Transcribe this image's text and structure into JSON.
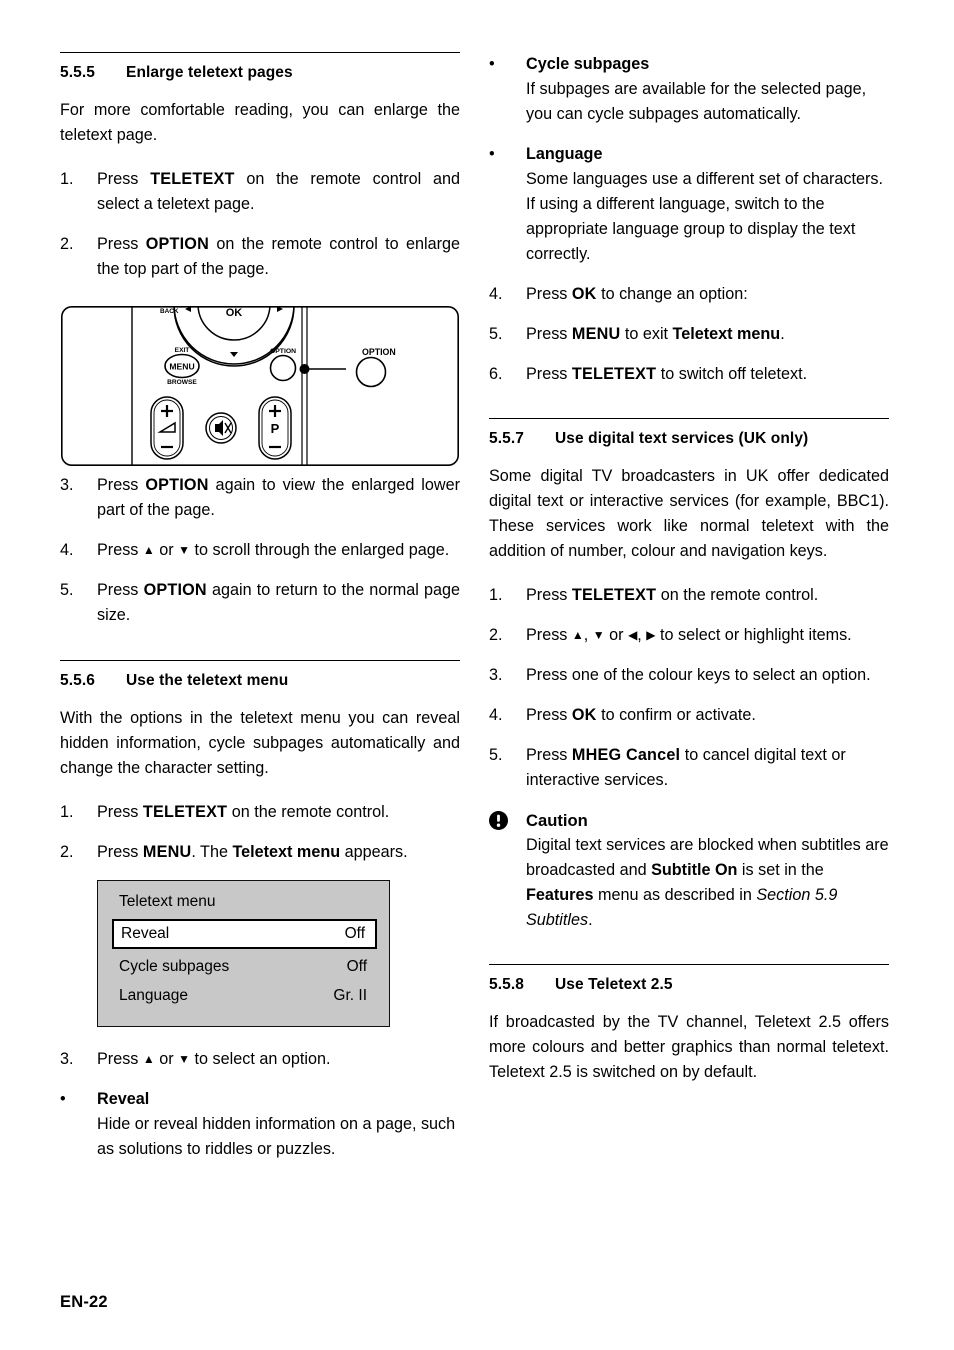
{
  "document": {
    "footer_page": "EN-22"
  },
  "left_column": {
    "section_555": {
      "number": "5.5.5",
      "title": "Enlarge teletext pages",
      "intro": "For more comfortable reading, you can enlarge the teletext page.",
      "steps": [
        {
          "mark": "1.",
          "parts": [
            {
              "t": "Press ",
              "s": "normal"
            },
            {
              "t": "TELETEXT",
              "s": "big"
            },
            {
              "t": " on the remote control and select a teletext page.",
              "s": "normal"
            }
          ]
        },
        {
          "mark": "2.",
          "parts": [
            {
              "t": "Press ",
              "s": "normal"
            },
            {
              "t": "OPTION",
              "s": "big"
            },
            {
              "t": " on the remote control to enlarge the top part of the page.",
              "s": "normal"
            }
          ]
        },
        {
          "mark": "3.",
          "parts": [
            {
              "t": "Press ",
              "s": "normal"
            },
            {
              "t": "OPTION",
              "s": "big"
            },
            {
              "t": " again to view the enlarged lower part of the page.",
              "s": "normal"
            }
          ]
        },
        {
          "mark": "4.",
          "parts": [
            {
              "t": "Press ",
              "s": "normal"
            },
            {
              "t": "▲",
              "s": "arrow"
            },
            {
              "t": " or ",
              "s": "normal"
            },
            {
              "t": "▼",
              "s": "arrow"
            },
            {
              "t": " to scroll through the enlarged page.",
              "s": "normal"
            }
          ]
        },
        {
          "mark": "5.",
          "parts": [
            {
              "t": "Press ",
              "s": "normal"
            },
            {
              "t": "OPTION",
              "s": "big"
            },
            {
              "t": " again to return to the normal page size.",
              "s": "normal"
            }
          ]
        }
      ]
    },
    "remote_figure": {
      "labels": {
        "back": "BACK",
        "ok": "OK",
        "exit": "EXIT",
        "menu": "MENU",
        "browse": "BROWSE",
        "option_small": "OPTION",
        "option_callout": "OPTION",
        "program": "P"
      }
    },
    "section_556": {
      "number": "5.5.6",
      "title": "Use the teletext menu",
      "intro": "With the options in the teletext menu you can reveal hidden information, cycle subpages automatically and change the character setting.",
      "steps_before_menu": [
        {
          "mark": "1.",
          "parts": [
            {
              "t": "Press ",
              "s": "normal"
            },
            {
              "t": "TELETEXT",
              "s": "big"
            },
            {
              "t": " on the remote control.",
              "s": "normal"
            }
          ]
        },
        {
          "mark": "2.",
          "parts": [
            {
              "t": "Press ",
              "s": "normal"
            },
            {
              "t": "MENU",
              "s": "big"
            },
            {
              "t": ". The ",
              "s": "normal"
            },
            {
              "t": "Teletext menu",
              "s": "bold"
            },
            {
              "t": " appears.",
              "s": "normal"
            }
          ]
        }
      ],
      "teletext_menu": {
        "title": "Teletext menu",
        "rows": [
          {
            "label": "Reveal",
            "value": "Off",
            "selected": true
          },
          {
            "label": "Cycle subpages",
            "value": "Off",
            "selected": false
          },
          {
            "label": "Language",
            "value": "Gr. II",
            "selected": false
          }
        ]
      },
      "steps_after_menu": [
        {
          "mark": "3.",
          "parts": [
            {
              "t": "Press ",
              "s": "normal"
            },
            {
              "t": "▲",
              "s": "arrow"
            },
            {
              "t": " or ",
              "s": "normal"
            },
            {
              "t": "▼",
              "s": "arrow"
            },
            {
              "t": " to select an option.",
              "s": "normal"
            }
          ]
        }
      ],
      "option_reveal": {
        "mark": "•",
        "title": "Reveal",
        "text": "Hide or reveal hidden information on a page, such as solutions to riddles or puzzles."
      }
    }
  },
  "right_column": {
    "option_cycle": {
      "mark": "•",
      "title": "Cycle subpages",
      "text": "If subpages are available for the selected page, you can cycle subpages automatically."
    },
    "option_language": {
      "mark": "•",
      "title": "Language",
      "text": "Some languages use a different set of characters. If using a different language, switch to the appropriate language group to display the text correctly."
    },
    "steps_556_cont": [
      {
        "mark": "4.",
        "parts": [
          {
            "t": "Press ",
            "s": "normal"
          },
          {
            "t": "OK",
            "s": "big"
          },
          {
            "t": " to change an option:",
            "s": "normal"
          }
        ]
      },
      {
        "mark": "5.",
        "parts": [
          {
            "t": "Press ",
            "s": "normal"
          },
          {
            "t": "MENU",
            "s": "big"
          },
          {
            "t": " to exit ",
            "s": "normal"
          },
          {
            "t": "Teletext menu",
            "s": "bold"
          },
          {
            "t": ".",
            "s": "normal"
          }
        ]
      },
      {
        "mark": "6.",
        "parts": [
          {
            "t": "Press ",
            "s": "normal"
          },
          {
            "t": "TELETEXT",
            "s": "big"
          },
          {
            "t": " to switch off teletext.",
            "s": "normal"
          }
        ]
      }
    ],
    "section_557": {
      "number": "5.5.7",
      "title": "Use digital text services (UK only)",
      "intro": "Some digital TV broadcasters in UK offer dedicated digital text or interactive services (for example, BBC1). These services work like normal teletext with the addition of number, colour and navigation keys.",
      "steps": [
        {
          "mark": "1.",
          "parts": [
            {
              "t": "Press ",
              "s": "normal"
            },
            {
              "t": "TELETEXT",
              "s": "big"
            },
            {
              "t": " on the remote control.",
              "s": "normal"
            }
          ]
        },
        {
          "mark": "2.",
          "parts": [
            {
              "t": "Press ",
              "s": "normal"
            },
            {
              "t": "▲",
              "s": "arrow"
            },
            {
              "t": ", ",
              "s": "normal"
            },
            {
              "t": "▼",
              "s": "arrow"
            },
            {
              "t": " or ",
              "s": "normal"
            },
            {
              "t": "◀",
              "s": "arrow"
            },
            {
              "t": ", ",
              "s": "normal"
            },
            {
              "t": "▶",
              "s": "arrow"
            },
            {
              "t": " to select or highlight items.",
              "s": "normal"
            }
          ]
        },
        {
          "mark": "3.",
          "parts": [
            {
              "t": "Press one of the colour keys to select an option.",
              "s": "normal"
            }
          ]
        },
        {
          "mark": "4.",
          "parts": [
            {
              "t": "Press ",
              "s": "normal"
            },
            {
              "t": "OK",
              "s": "big"
            },
            {
              "t": " to confirm or activate.",
              "s": "normal"
            }
          ]
        },
        {
          "mark": "5.",
          "parts": [
            {
              "t": "Press ",
              "s": "normal"
            },
            {
              "t": "MHEG Cancel",
              "s": "big"
            },
            {
              "t": " to cancel digital text or interactive services.",
              "s": "normal"
            }
          ]
        }
      ],
      "caution": {
        "icon": "exclamation-circle-icon",
        "title": "Caution",
        "parts": [
          {
            "t": "Digital text services are blocked when subtitles are broadcasted and ",
            "s": "normal"
          },
          {
            "t": "Subtitle On",
            "s": "bold"
          },
          {
            "t": " is set in the ",
            "s": "normal"
          },
          {
            "t": "Features",
            "s": "bold"
          },
          {
            "t": " menu as described in ",
            "s": "normal"
          },
          {
            "t": "Section 5.9 Subtitles",
            "s": "italic"
          },
          {
            "t": ".",
            "s": "normal"
          }
        ]
      }
    },
    "section_558": {
      "number": "5.5.8",
      "title": "Use Teletext 2.5",
      "intro": "If broadcasted by the TV channel, Teletext 2.5 offers more colours and better graphics than normal teletext. Teletext 2.5 is switched on by default."
    }
  }
}
